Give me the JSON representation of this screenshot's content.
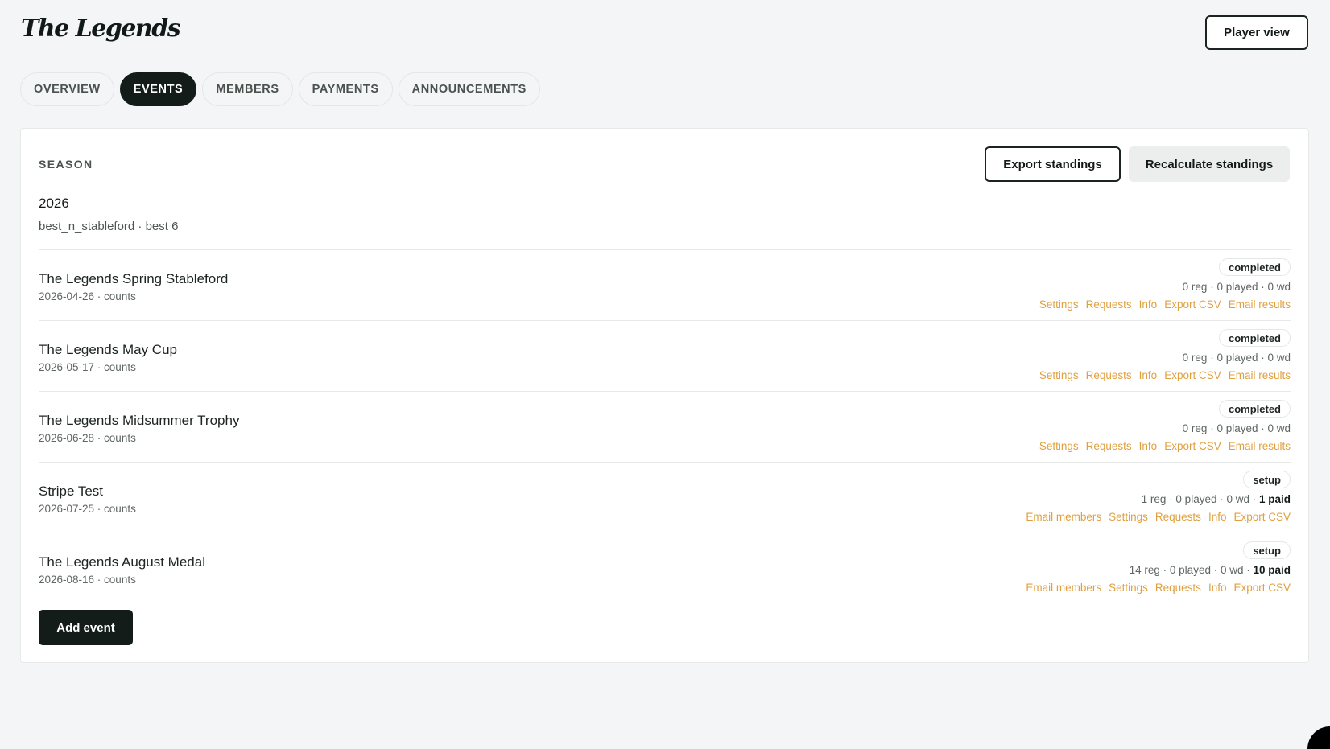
{
  "app": {
    "logo": "The Legends",
    "player_view_label": "Player view"
  },
  "tabs": [
    {
      "label": "OVERVIEW",
      "active": false
    },
    {
      "label": "EVENTS",
      "active": true
    },
    {
      "label": "MEMBERS",
      "active": false
    },
    {
      "label": "PAYMENTS",
      "active": false
    },
    {
      "label": "ANNOUNCEMENTS",
      "active": false
    }
  ],
  "season": {
    "label": "SEASON",
    "year": "2026",
    "format": "best_n_stableford · best 6",
    "export_label": "Export standings",
    "recalc_label": "Recalculate standings"
  },
  "events": [
    {
      "name": "The Legends Spring Stableford",
      "meta": "2026-04-26 · counts",
      "status": "completed",
      "stats": "0 reg · 0 played · 0 wd",
      "paid": "",
      "links": [
        "Settings",
        "Requests",
        "Info",
        "Export CSV",
        "Email results"
      ]
    },
    {
      "name": "The Legends May Cup",
      "meta": "2026-05-17 · counts",
      "status": "completed",
      "stats": "0 reg · 0 played · 0 wd",
      "paid": "",
      "links": [
        "Settings",
        "Requests",
        "Info",
        "Export CSV",
        "Email results"
      ]
    },
    {
      "name": "The Legends Midsummer Trophy",
      "meta": "2026-06-28 · counts",
      "status": "completed",
      "stats": "0 reg · 0 played · 0 wd",
      "paid": "",
      "links": [
        "Settings",
        "Requests",
        "Info",
        "Export CSV",
        "Email results"
      ]
    },
    {
      "name": "Stripe Test",
      "meta": "2026-07-25 · counts",
      "status": "setup",
      "stats": "1 reg · 0 played · 0 wd · ",
      "paid": "1 paid",
      "links": [
        "Email members",
        "Settings",
        "Requests",
        "Info",
        "Export CSV"
      ]
    },
    {
      "name": "The Legends August Medal",
      "meta": "2026-08-16 · counts",
      "status": "setup",
      "stats": "14 reg · 0 played · 0 wd · ",
      "paid": "10 paid",
      "links": [
        "Email members",
        "Settings",
        "Requests",
        "Info",
        "Export CSV"
      ]
    }
  ],
  "add_event_label": "Add event",
  "colors": {
    "link": "#e0a040",
    "dark": "#131c18",
    "background": "#f3f5f6"
  }
}
